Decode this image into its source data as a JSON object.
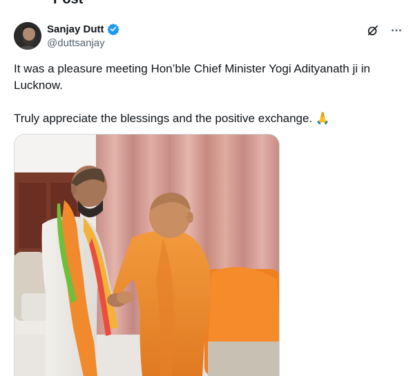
{
  "page": {
    "title": "Post"
  },
  "author": {
    "display_name": "Sanjay Dutt",
    "handle": "@duttsanjay",
    "verified": true
  },
  "post": {
    "paragraphs": [
      "It was a pleasure meeting Hon’ble Chief Minister Yogi Adityanath ji in Lucknow.",
      "Truly appreciate the blessings and the positive exchange. 🙏"
    ]
  },
  "icons": {
    "verified": "verified-badge-icon",
    "grok": "grok-icon",
    "more": "more-icon",
    "pray": "folded-hands-emoji"
  },
  "colors": {
    "verified_blue": "#1d9bf0",
    "secondary_text": "#536471",
    "primary_text": "#0f1419",
    "curtain": "#d9a39b",
    "saffron": "#f0852a"
  }
}
